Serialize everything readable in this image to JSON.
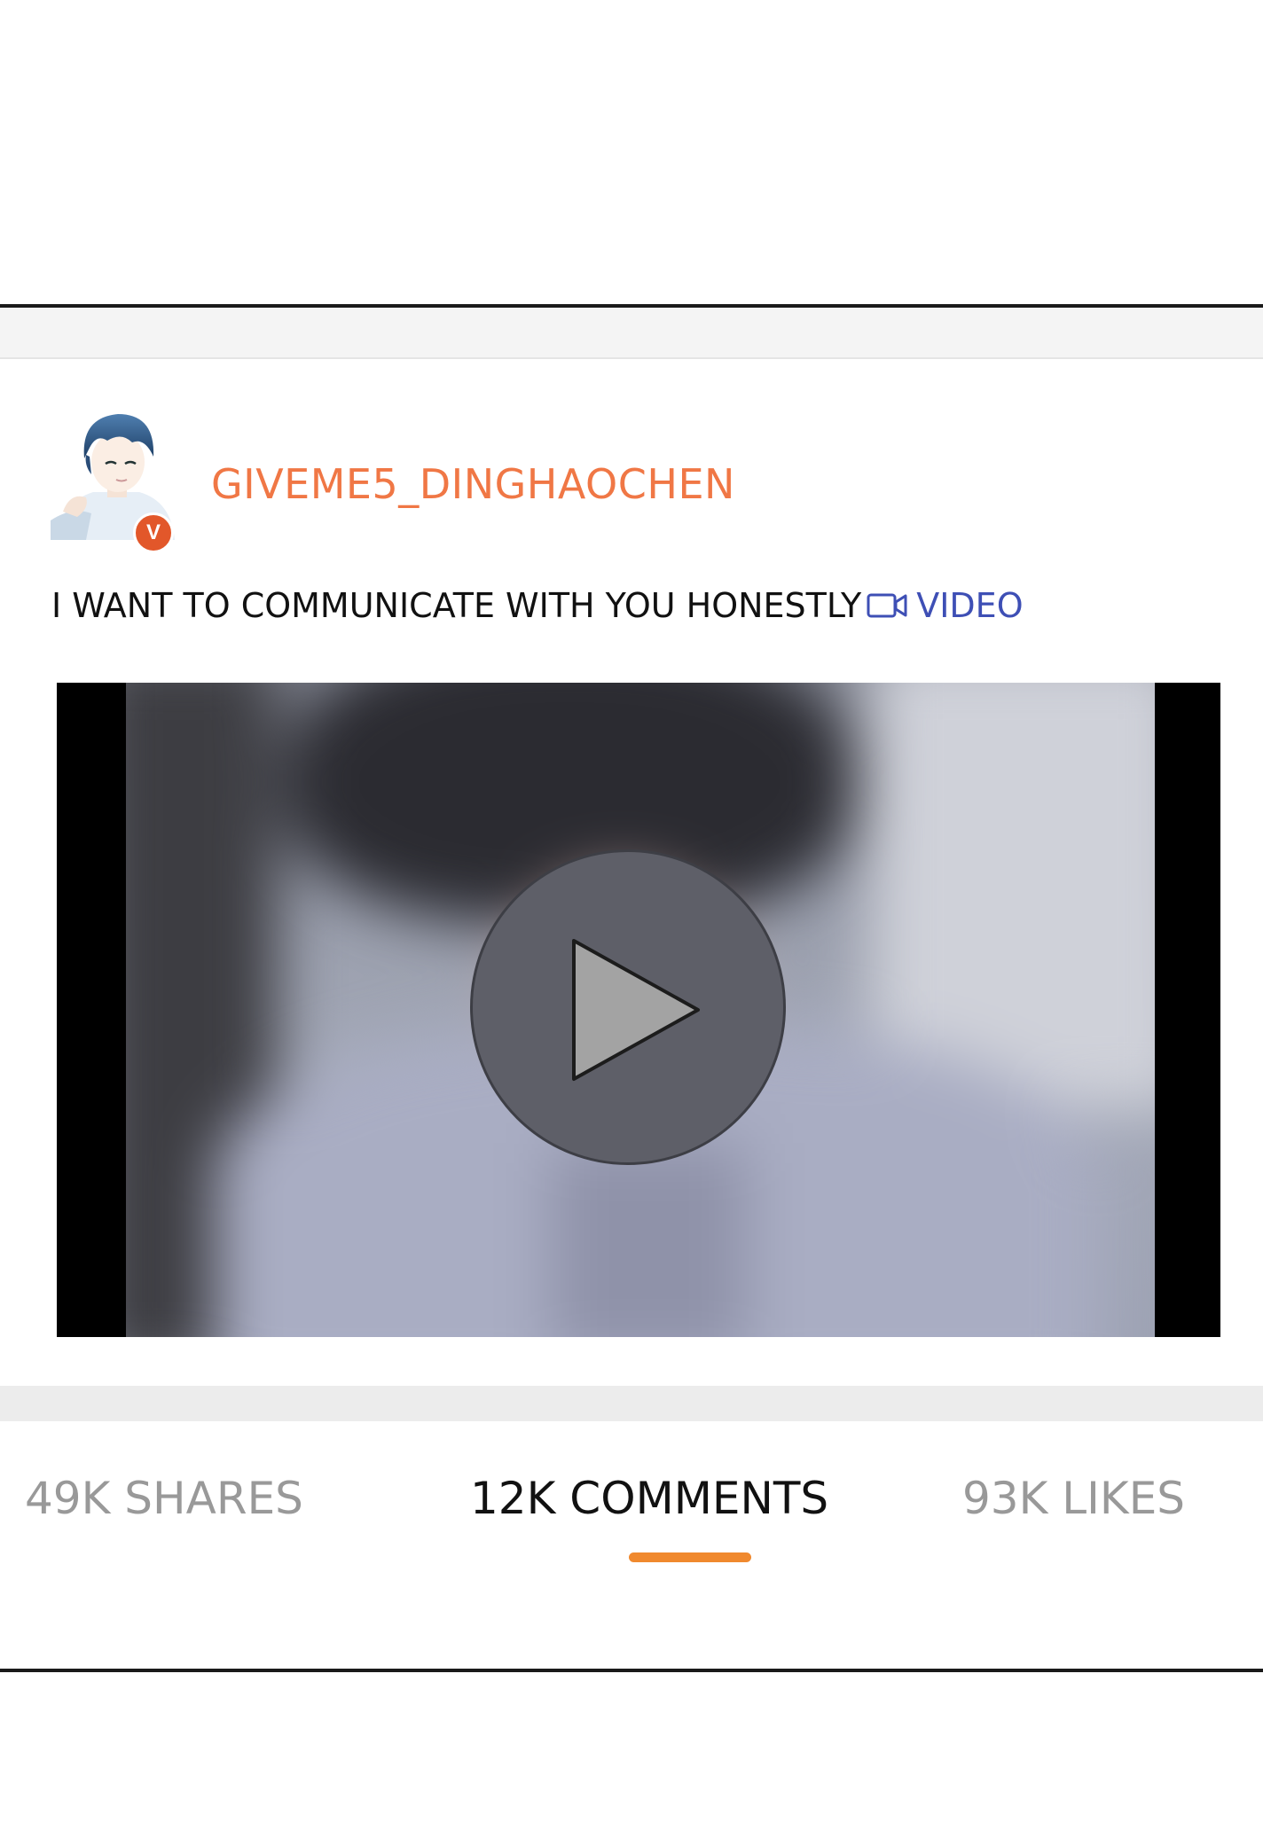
{
  "post": {
    "username": "GIVEME5_DINGHAOCHEN",
    "verified_badge": "V",
    "text": "I WANT TO COMMUNICATE WITH YOU HONESTLY",
    "video_link_label": "VIDEO",
    "video_link_icon": "video-camera-icon"
  },
  "video": {
    "play_icon": "play-icon"
  },
  "stats": {
    "shares": "49K SHARES",
    "comments": "12K COMMENTS",
    "likes": "93K LIKES",
    "active_tab": "comments"
  },
  "colors": {
    "username": "#f07745",
    "video_link": "#3e4fb5",
    "active_indicator": "#f0892e",
    "inactive_tab": "#999999",
    "active_tab": "#111111"
  }
}
